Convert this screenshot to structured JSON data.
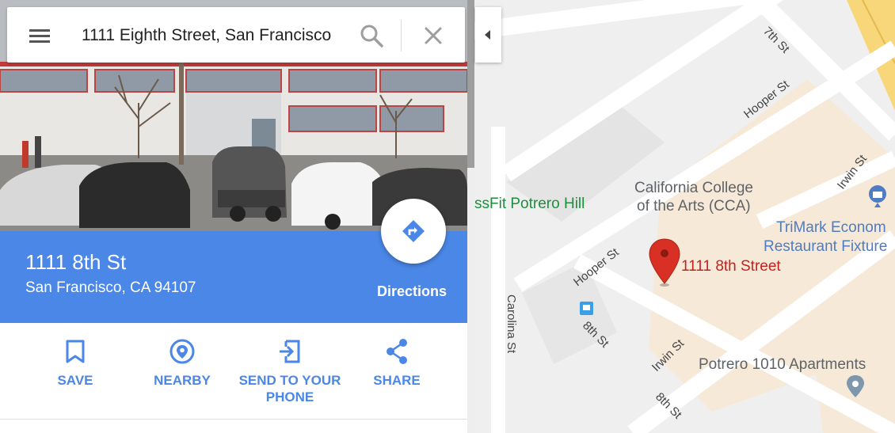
{
  "search": {
    "value": "1111 Eighth Street, San Francisco",
    "menu_icon": "hamburger-menu-icon",
    "search_icon": "magnifier-icon",
    "clear_icon": "close-icon"
  },
  "place": {
    "title": "1111 8th St",
    "subtitle": "San Francisco, CA 94107",
    "directions_label": "Directions",
    "directions_icon": "turn-right-arrow-icon"
  },
  "actions": [
    {
      "label": "SAVE",
      "icon": "bookmark-icon"
    },
    {
      "label": "NEARBY",
      "icon": "location-target-icon"
    },
    {
      "label": "SEND TO YOUR PHONE",
      "icon": "send-to-phone-icon"
    },
    {
      "label": "SHARE",
      "icon": "share-icon"
    }
  ],
  "map": {
    "streets": [
      "7th St",
      "Hooper St",
      "Irwin St",
      "Hooper St",
      "Carolina St",
      "8th St",
      "Irwin St",
      "8th St"
    ],
    "places": [
      {
        "name": "California College",
        "name2": "of the Arts (CCA)"
      },
      {
        "name": "TriMark Econom",
        "name2": "Restaurant Fixture"
      },
      {
        "name": "Potrero 1010 Apartments"
      },
      {
        "name": "ssFit Potrero Hill"
      }
    ],
    "pin_label": "1111 8th Street"
  },
  "colors": {
    "accent": "#4b87e6",
    "pin": "#d93025",
    "poi_green": "#1e8e3e",
    "poi_blue": "#4f7cc2",
    "map_bg": "#efefef",
    "road": "#ffffff",
    "highway": "#f7d77a"
  }
}
